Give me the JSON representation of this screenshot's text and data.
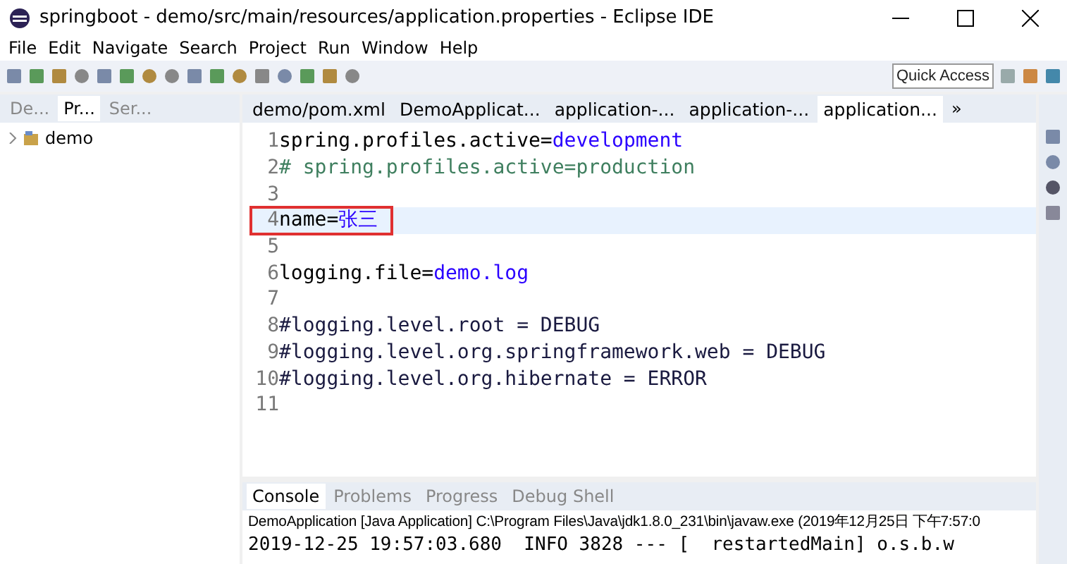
{
  "window": {
    "title": "springboot - demo/src/main/resources/application.properties - Eclipse IDE"
  },
  "menu": [
    "File",
    "Edit",
    "Navigate",
    "Search",
    "Project",
    "Run",
    "Window",
    "Help"
  ],
  "quick_access": {
    "placeholder": "Quick Access"
  },
  "side_tabs": [
    {
      "label": "De...",
      "selected": false
    },
    {
      "label": "Pr...",
      "selected": true
    },
    {
      "label": "Ser...",
      "selected": false
    }
  ],
  "tree": [
    {
      "label": "demo",
      "expanded": false
    }
  ],
  "editor_tabs": [
    {
      "label": "demo/pom.xml",
      "selected": false
    },
    {
      "label": "DemoApplicat...",
      "selected": false
    },
    {
      "label": "application-...",
      "selected": false
    },
    {
      "label": "application-...",
      "selected": false
    },
    {
      "label": "application...",
      "selected": true
    }
  ],
  "editor_overflow": "»",
  "code_lines": [
    {
      "number": "1",
      "kind": "property",
      "key": "spring.profiles.active=",
      "value": "development",
      "current": false,
      "boxed": false
    },
    {
      "number": "2",
      "kind": "comment",
      "text": "# spring.profiles.active=production",
      "current": false,
      "boxed": false
    },
    {
      "number": "3",
      "kind": "empty",
      "current": false,
      "boxed": false
    },
    {
      "number": "4",
      "kind": "property",
      "key": "name=",
      "value": "张三",
      "current": true,
      "boxed": true
    },
    {
      "number": "5",
      "kind": "empty",
      "current": false,
      "boxed": false
    },
    {
      "number": "6",
      "kind": "property",
      "key": "logging.file=",
      "value": "demo.log",
      "current": false,
      "boxed": false
    },
    {
      "number": "7",
      "kind": "empty",
      "current": false,
      "boxed": false
    },
    {
      "number": "8",
      "kind": "plain",
      "text": "#logging.level.root = DEBUG",
      "current": false,
      "boxed": false
    },
    {
      "number": "9",
      "kind": "plain",
      "text": "#logging.level.org.springframework.web = DEBUG",
      "current": false,
      "boxed": false
    },
    {
      "number": "10",
      "kind": "plain",
      "text": "#logging.level.org.hibernate = ERROR",
      "current": false,
      "boxed": false
    },
    {
      "number": "11",
      "kind": "empty",
      "current": false,
      "boxed": false
    }
  ],
  "console_tabs": [
    {
      "label": "Console",
      "selected": true
    },
    {
      "label": "Problems",
      "selected": false
    },
    {
      "label": "Progress",
      "selected": false
    },
    {
      "label": "Debug Shell",
      "selected": false
    }
  ],
  "console": {
    "header": "DemoApplication [Java Application] C:\\Program Files\\Java\\jdk1.8.0_231\\bin\\javaw.exe (2019年12月25日 下午7:57:0",
    "line": "2019-12-25 19:57:03.680  INFO 3828 --- [  restartedMain] o.s.b.w"
  }
}
